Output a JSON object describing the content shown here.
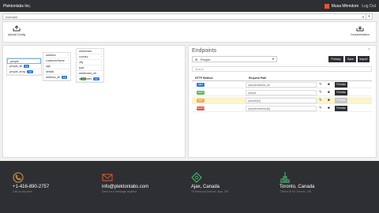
{
  "header": {
    "brand": "Plektonlabs Inc.",
    "user_name": "Musa Mhmdom",
    "logout": "Log Out"
  },
  "search": {
    "value": "example",
    "plus": "+"
  },
  "toolbar": {
    "upload_label": "Upload Config",
    "documentation_label": "Documentation"
  },
  "columns": [
    {
      "items": [
        {
          "label": "people",
          "selected": true,
          "caret": true
        },
        {
          "label": "people_all",
          "badge": "14",
          "badge_color": "blue"
        },
        {
          "label": "people_array",
          "badge": "14",
          "badge_color": "blue"
        }
      ]
    },
    {
      "items": [
        {
          "label": "address",
          "caret": true
        },
        {
          "label": "customerName",
          "caret": true
        },
        {
          "label": "age",
          "caret": false
        },
        {
          "label": "details",
          "caret": true
        },
        {
          "label": "address_all",
          "badge": "14",
          "badge_color": "blue"
        }
      ]
    },
    {
      "items": [
        {
          "label": "addresses",
          "caret": true
        },
        {
          "label": "country",
          "caret": true
        },
        {
          "label": "city",
          "caret": true
        },
        {
          "label": "type",
          "caret": true
        },
        {
          "label": "addresses_all",
          "badge": "14",
          "badge_color": "green"
        },
        {
          "label": "addresses",
          "badge": "10",
          "badge_color": "blue"
        }
      ]
    }
  ],
  "endpoints": {
    "title": "Endpoints",
    "close": "×",
    "select_value": "People",
    "buttons": [
      "Primary",
      "Save",
      "Import"
    ],
    "search_placeholder": "Search",
    "col_method": "HTTP Method",
    "col_path": "Request Path",
    "preview_label": "Preview",
    "rows": [
      {
        "method": "GET",
        "color": "#2f7ed8",
        "path": "/people/address_all",
        "highlight": false,
        "dim": false
      },
      {
        "method": "POST",
        "color": "#5cb85c",
        "path": "/people",
        "highlight": false,
        "dim": false
      },
      {
        "method": "PUT",
        "color": "#f0ad4e",
        "path": "/people/{id}",
        "highlight": true,
        "dim": true
      },
      {
        "method": "DELETE",
        "color": "#d9534f",
        "path": "/people/address/{id}",
        "highlight": false,
        "dim": false
      }
    ]
  },
  "footer": {
    "items": [
      {
        "title": "+1-416-890-2757",
        "sub": "Call us any time"
      },
      {
        "title": "info@plektonlabs.com",
        "sub": "Send us a message anytime"
      },
      {
        "title": "Ajax, Canada",
        "sub": "70 Harwood Avenue, Ajax, ON"
      },
      {
        "title": "Toronto, Canada",
        "sub": "2 Bloor St W, Toronto, ON"
      }
    ],
    "colors": {
      "phone": "#e59a3c",
      "mail": "#e4572e",
      "map": "#4fbf74",
      "tower": "#4fbf74"
    }
  }
}
